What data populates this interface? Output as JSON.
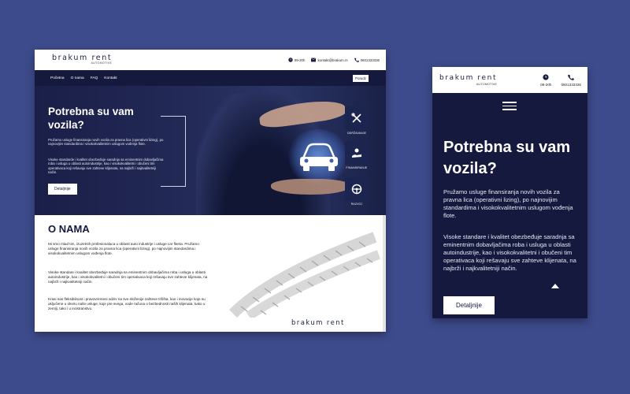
{
  "desktop": {
    "logo": {
      "wordmark": "brakum rent",
      "sub": "AUTOMOTIVE"
    },
    "contact": {
      "hours": "09-20h",
      "email": "kontakt@brakum.rs",
      "phone": "0601333336"
    },
    "nav": {
      "items": [
        "Početna",
        "O nama",
        "FAQ",
        "Kontakt"
      ],
      "order_button": "Porudz"
    },
    "hero": {
      "title": "Potrebna su vam vozila?",
      "p1": "Pružamo usluge finansiranja novih vozila za pravna lica (operativni lizing), po najnovijim standardima i visokokvalitetnim uslugom vođenja flote.",
      "p2": "Visoke standarde i kvalitet obezbeđuje saradnja sa eminentnim dobavljačima roba i usluga u oblasti autoindustrije, kao i visokokvalitetni i obučeni tim operativaca koji rešavaju sve zahteve klijenata, na najbrži i najkvalitetniji način.",
      "button": "Detaljnije",
      "services": [
        "ODRŽAVANJE",
        "FINANSIRANJE",
        "RAZVOJ"
      ]
    },
    "about": {
      "title": "O NAMA",
      "p1": "Mi smo mlad tim, izuzetnih profesionalaca u oblasti auto industrije i usluge car fleeta. Pružamo usluge finansiranja novih vozila za pravna lica (operativni lizing), po najnovijim standardima i visokokvalitetnim uslugom vođenja flote.",
      "p2": "Visoke standare i kvalitet obezbeđuje saradnja sa eminentnim dobavljačima roba i usluga u oblasti autoindustrije, kao i visokokvalitetni i obučeni tim operativaca koji rešavaju sve zahteve klijenata, na najbrži i najkvalitetniji način.",
      "p3": "Krasi nas fleksibilnost i pravovremeni odziv na sve složenije zahteve tržišta, kao i inovacije koje su uključene u okviru naše usluge, koje pre svega, vode računa o bezbednosti naših klijenata, kako u zemlji, tako i u inostranstvu.",
      "brand": "brakum rent"
    }
  },
  "mobile": {
    "logo": {
      "wordmark": "brakum rent",
      "sub": "AUTOMOTIVE"
    },
    "contact": {
      "hours": "09-20h",
      "phone": "0601333336"
    },
    "hero": {
      "title": "Potrebna su vam vozila?",
      "p1": "Pružamo usluge finansiranja novih vozila za pravna lica (operativni lizing), po najnovijim standardima i visokokvalitetnim uslugom vođenja flote.",
      "p2": "Visoke standare i kvalitet obezbeđuje saradnja sa eminentnim dobavljačima roba i usluga u oblasti autoindustrije, kao i visokokvalitetni i obučeni tim operativaca koji rešavaju sve zahteve klijenata, na najbrži i najkvalitetniji način.",
      "button": "Detaljnije"
    }
  },
  "colors": {
    "background": "#3d4b8c",
    "navy": "#15193d",
    "white": "#ffffff"
  }
}
